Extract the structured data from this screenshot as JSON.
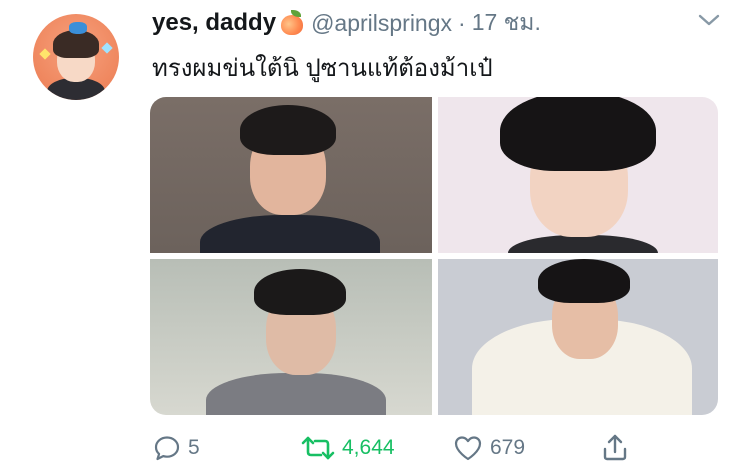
{
  "tweet": {
    "display_name": "yes, daddy",
    "handle": "@aprilspringx",
    "separator": "·",
    "time": "17 ชม.",
    "text": "ทรงผมข่นใต้นิ ปูซานแท้ต้องม้าเป๋"
  },
  "icons": {
    "name_emoji": "peach-emoji",
    "menu": "chevron-down-icon",
    "reply": "reply-icon",
    "retweet": "retweet-icon",
    "like": "heart-icon",
    "share": "share-icon"
  },
  "actions": {
    "reply_count": "5",
    "retweet_count": "4,644",
    "like_count": "679"
  },
  "colors": {
    "text": "#14171a",
    "secondary": "#657786",
    "retweet_active": "#17bf63"
  }
}
